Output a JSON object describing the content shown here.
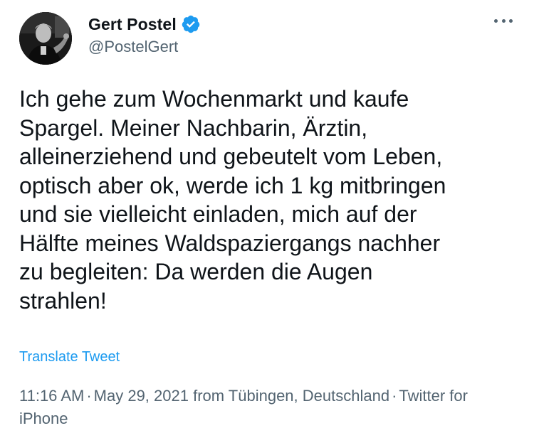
{
  "author": {
    "display_name": "Gert Postel",
    "handle": "@PostelGert",
    "verified": true,
    "avatar_icon": "profile-photo"
  },
  "tweet": {
    "text": "Ich gehe zum Wochenmarkt und kaufe\nSpargel. Meiner Nachbarin, Ärztin,\nalleinerziehend und gebeutelt vom Leben,\noptisch aber ok, werde ich 1 kg mitbringen\nund sie vielleicht einladen, mich auf der\nHälfte meines Waldspaziergangs nachher\nzu begleiten: Da werden die Augen\nstrahlen!",
    "translate_label": "Translate Tweet",
    "time": "11:16 AM",
    "separator": "·",
    "date": "May 29, 2021",
    "location": "from Tübingen, Deutschland",
    "source": "Twitter for iPhone"
  },
  "colors": {
    "link": "#1d9bf0",
    "secondary": "#536471",
    "primary": "#0f1419"
  }
}
